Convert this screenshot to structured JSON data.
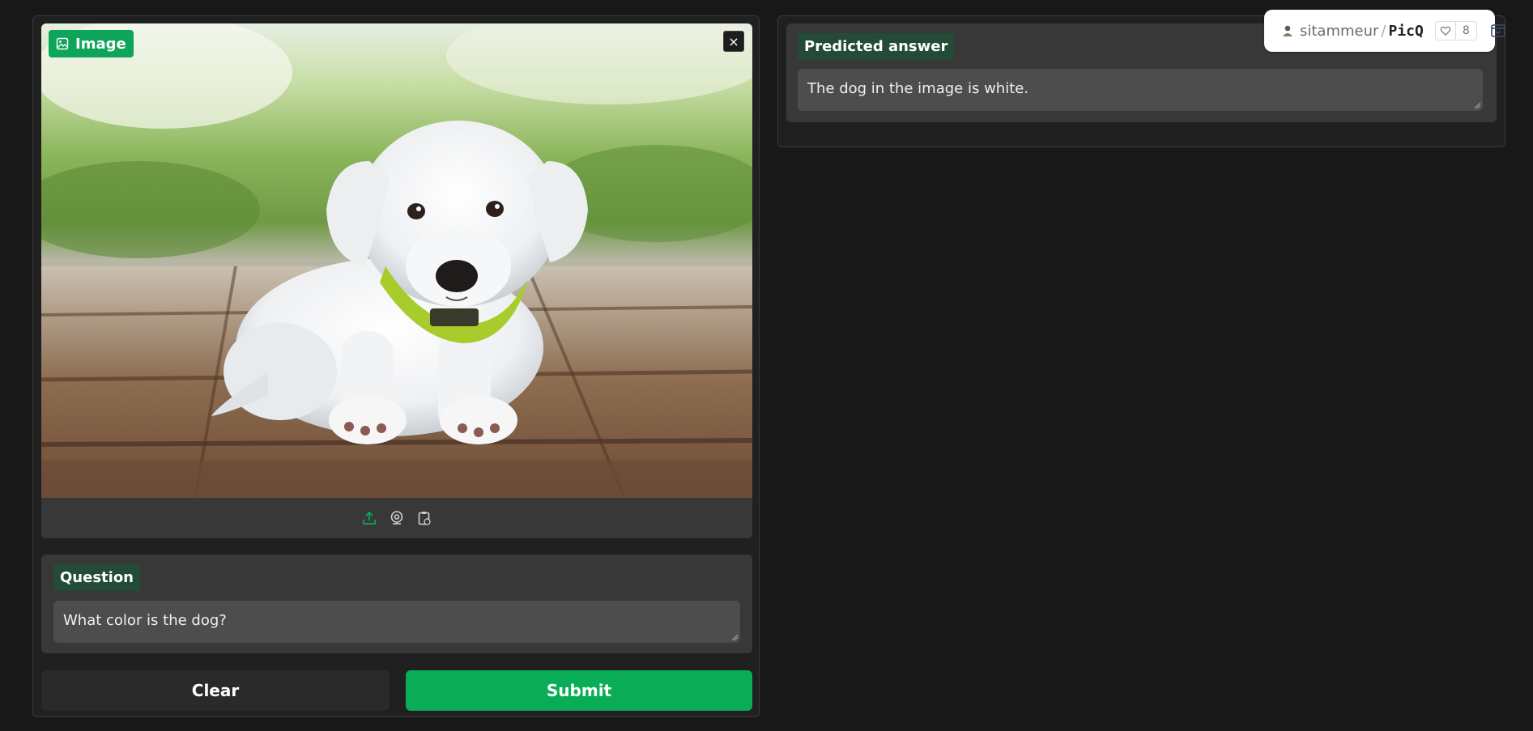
{
  "left_panel": {
    "image_label": "Image",
    "close_glyph": "×",
    "toolbar": [
      {
        "icon": "upload-icon",
        "color": "#0ea55a"
      },
      {
        "icon": "webcam-icon",
        "color": "#d0d0d0"
      },
      {
        "icon": "clipboard-icon",
        "color": "#d0d0d0"
      }
    ],
    "question": {
      "label": "Question",
      "value": "What color is the dog?"
    },
    "buttons": {
      "clear": "Clear",
      "submit": "Submit"
    }
  },
  "right_panel": {
    "answer": {
      "label": "Predicted answer",
      "value": "The dog in the image is white."
    }
  },
  "space_header": {
    "owner": "sitammeur",
    "separator": "/",
    "repo": "PicQ",
    "likes": "8"
  },
  "colors": {
    "accent": "#0aad55",
    "label_bg": "#244b38",
    "page_bg": "#181818"
  }
}
